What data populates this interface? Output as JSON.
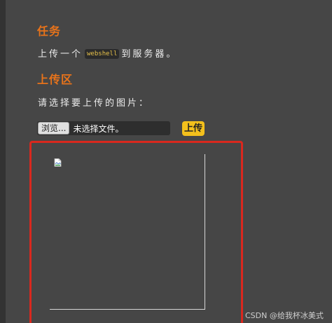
{
  "task": {
    "title": "任务",
    "text_before": "上传一个",
    "code": "webshell",
    "text_after": "到服务器。"
  },
  "upload_section": {
    "title": "上传区",
    "prompt": "请选择要上传的图片：",
    "browse_label": "浏览...",
    "no_file_text": "未选择文件。",
    "upload_label": "上传"
  },
  "watermark": "CSDN @给我杯冰美式",
  "icons": {
    "preview": "broken-image-icon"
  },
  "colors": {
    "accent": "#e8731a",
    "button": "#f3c01c",
    "highlight_border": "#d9281e",
    "code": "#e8c24a"
  }
}
